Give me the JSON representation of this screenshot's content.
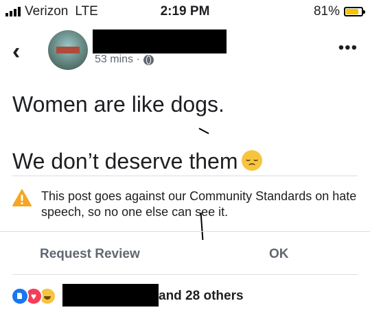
{
  "status_bar": {
    "carrier": "Verizon",
    "network": "LTE",
    "time": "2:19 PM",
    "battery_percent": "81%",
    "battery_level": 0.81,
    "battery_color": "#f5c400"
  },
  "post": {
    "timestamp": "53 mins ·",
    "privacy_icon": "globe-icon",
    "line1": "Women are like dogs.",
    "line2": "We don’t deserve them",
    "emoji": "disappointed-face"
  },
  "warning": {
    "icon": "warning-triangle-icon",
    "text": "This post goes against our Community Standards on hate speech, so no one else can see it."
  },
  "actions": {
    "request_review": "Request Review",
    "ok": "OK"
  },
  "reactions": {
    "icons": [
      "like-icon",
      "love-icon",
      "haha-icon"
    ],
    "summary": "and 28 others"
  },
  "colors": {
    "like": "#1877f2",
    "love": "#f33e58",
    "warning": "#f5a623"
  }
}
